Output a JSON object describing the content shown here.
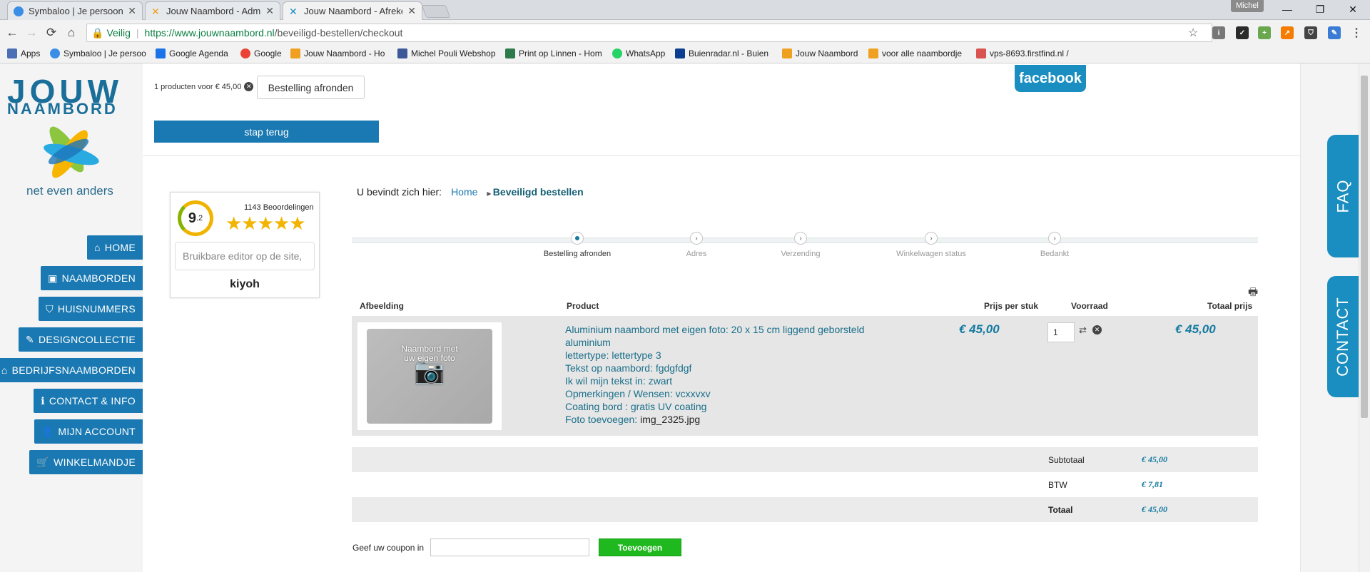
{
  "browser": {
    "tabs": [
      {
        "title": "Symbaloo | Je persoonlijke"
      },
      {
        "title": "Jouw Naambord - Admin"
      },
      {
        "title": "Jouw Naambord - Afreken"
      }
    ],
    "user": "Michel",
    "window_controls": {
      "minimize": "—",
      "maximize": "❐",
      "close": "✕"
    },
    "nav": {
      "back": "←",
      "forward": "→",
      "reload": "⟳",
      "home": "⌂"
    },
    "address": {
      "secure_label": "Veilig",
      "host": "https://www.jouwnaambord.nl",
      "path": "/beveiligd-bestellen/checkout"
    },
    "bookmarks": [
      {
        "label": "Apps",
        "color": "#4a6fb5"
      },
      {
        "label": "Symbaloo | Je persoo",
        "color": "#3a8ee6"
      },
      {
        "label": "Google Agenda",
        "color": "#1a73e8"
      },
      {
        "label": "Google",
        "color": "#ea4335"
      },
      {
        "label": "Jouw Naambord - Ho",
        "color": "#f0a020"
      },
      {
        "label": "Michel Pouli Webshop",
        "color": "#3b5998"
      },
      {
        "label": "Print op Linnen - Hom",
        "color": "#2d7a4a"
      },
      {
        "label": "WhatsApp",
        "color": "#25d366"
      },
      {
        "label": "Buienradar.nl - Buien",
        "color": "#0b3d91"
      },
      {
        "label": "Jouw Naambord",
        "color": "#f0a020"
      },
      {
        "label": "voor alle naambordje",
        "color": "#f0a020"
      },
      {
        "label": "vps-8693.firstfind.nl /",
        "color": "#d9534f"
      }
    ]
  },
  "site": {
    "logo": {
      "line1": "JOUW",
      "line2": "NAAMBORD",
      "tagline": "net even anders"
    },
    "nav": [
      {
        "label": "HOME",
        "icon": "⌂"
      },
      {
        "label": "NAAMBORDEN",
        "icon": "▣"
      },
      {
        "label": "HUISNUMMERS",
        "icon": "⛉"
      },
      {
        "label": "DESIGNCOLLECTIE",
        "icon": "✎"
      },
      {
        "label": "BEDRIJFSNAAMBORDEN",
        "icon": "⌂"
      },
      {
        "label": "CONTACT & INFO",
        "icon": "ℹ"
      },
      {
        "label": "MIJN ACCOUNT",
        "icon": "👤"
      },
      {
        "label": "WINKELMANDJE",
        "icon": "🛒"
      }
    ],
    "cart_summary": "1 producten voor € 45,00",
    "finish_button": "Bestelling afronden",
    "back_button": "stap terug",
    "facebook": "facebook",
    "side_tabs": {
      "faq": "FAQ",
      "contact": "CONTACT"
    },
    "kiyoh": {
      "score": "9",
      "score_dec": ".2",
      "reviews": "1143 Beoordelingen",
      "stars": "★★★★★",
      "review_text": "Bruikbare editor op de site,",
      "brand": "kiyoh"
    },
    "breadcrumb": {
      "label": "U bevindt zich hier:",
      "home": "Home",
      "current": "Beveiligd bestellen"
    },
    "steps": [
      "Bestelling afronden",
      "Adres",
      "Verzending",
      "Winkelwagen status",
      "Bedankt"
    ],
    "table": {
      "headers": {
        "image": "Afbeelding",
        "product": "Product",
        "unit_price": "Prijs per stuk",
        "stock": "Voorraad",
        "total": "Totaal prijs"
      },
      "item": {
        "thumb_text": "Naambord met uw eigen foto",
        "title": "Aluminium naambord met eigen foto: 20 x 15 cm liggend geborsteld aluminium",
        "font": "lettertype: lettertype 3",
        "text": "Tekst op naambord: fgdgfdgf",
        "color": "Ik wil mijn tekst in: zwart",
        "remarks": "Opmerkingen / Wensen: vcxxvxv",
        "coating": "Coating bord : gratis UV coating",
        "photo_label": "Foto toevoegen:",
        "photo_file": "img_2325.jpg",
        "unit_price": "€ 45,00",
        "quantity": "1",
        "total": "€ 45,00"
      }
    },
    "totals": [
      {
        "label": "Subtotaal",
        "value": "€ 45,00"
      },
      {
        "label": "BTW",
        "value": "€ 7,81"
      },
      {
        "label": "Totaal",
        "value": "€ 45,00"
      }
    ],
    "coupon": {
      "label": "Geef uw coupon in",
      "button": "Toevoegen"
    }
  }
}
